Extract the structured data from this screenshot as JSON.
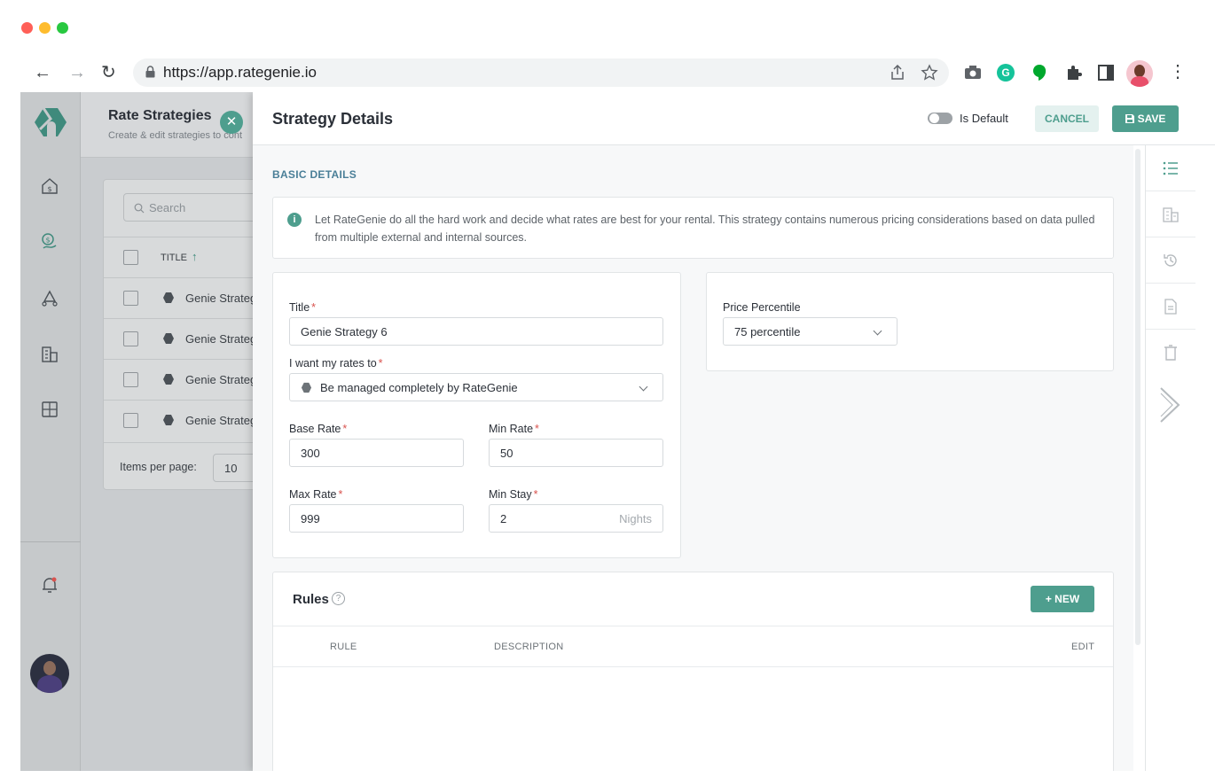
{
  "browser": {
    "url": "https://app.rategenie.io",
    "traffic_lights": [
      "#ff5f57",
      "#febc2e",
      "#28c840"
    ]
  },
  "sidebar": {
    "items": [
      "home-dollar-icon",
      "rate-strategy-icon",
      "recycle-icon",
      "buildings-icon",
      "puzzle-icon",
      "bell-icon",
      "avatar"
    ]
  },
  "background_page": {
    "title": "Rate Strategies",
    "subtitle": "Create & edit strategies to cont",
    "search_placeholder": "Search",
    "column_title": "TITLE",
    "rows": [
      "Genie Strateg",
      "Genie Strateg",
      "Genie Strateg",
      "Genie Strateg"
    ],
    "items_per_page_label": "Items per page:",
    "items_per_page_value": "10"
  },
  "panel": {
    "title": "Strategy Details",
    "is_default_label": "Is Default",
    "cancel_label": "CANCEL",
    "save_label": "SAVE",
    "section_title": "BASIC DETAILS",
    "info_text": "Let RateGenie do all the hard work and decide what rates are best for your rental. This strategy contains numerous pricing considerations based on data pulled from multiple external and internal sources.",
    "fields": {
      "title_label": "Title",
      "title_value": "Genie Strategy 6",
      "rates_label": "I want my rates to",
      "rates_value": "Be managed completely by RateGenie",
      "base_rate_label": "Base Rate",
      "base_rate_value": "300",
      "min_rate_label": "Min Rate",
      "min_rate_value": "50",
      "max_rate_label": "Max Rate",
      "max_rate_value": "999",
      "min_stay_label": "Min Stay",
      "min_stay_value": "2",
      "min_stay_suffix": "Nights",
      "price_percentile_label": "Price Percentile",
      "price_percentile_value": "75 percentile"
    },
    "rules": {
      "title": "Rules",
      "new_label": "+ NEW",
      "columns": [
        "RULE",
        "DESCRIPTION",
        "EDIT"
      ]
    }
  },
  "colors": {
    "accent": "#4e9e8e",
    "section_title": "#4a7f98",
    "required": "#d9534f"
  }
}
